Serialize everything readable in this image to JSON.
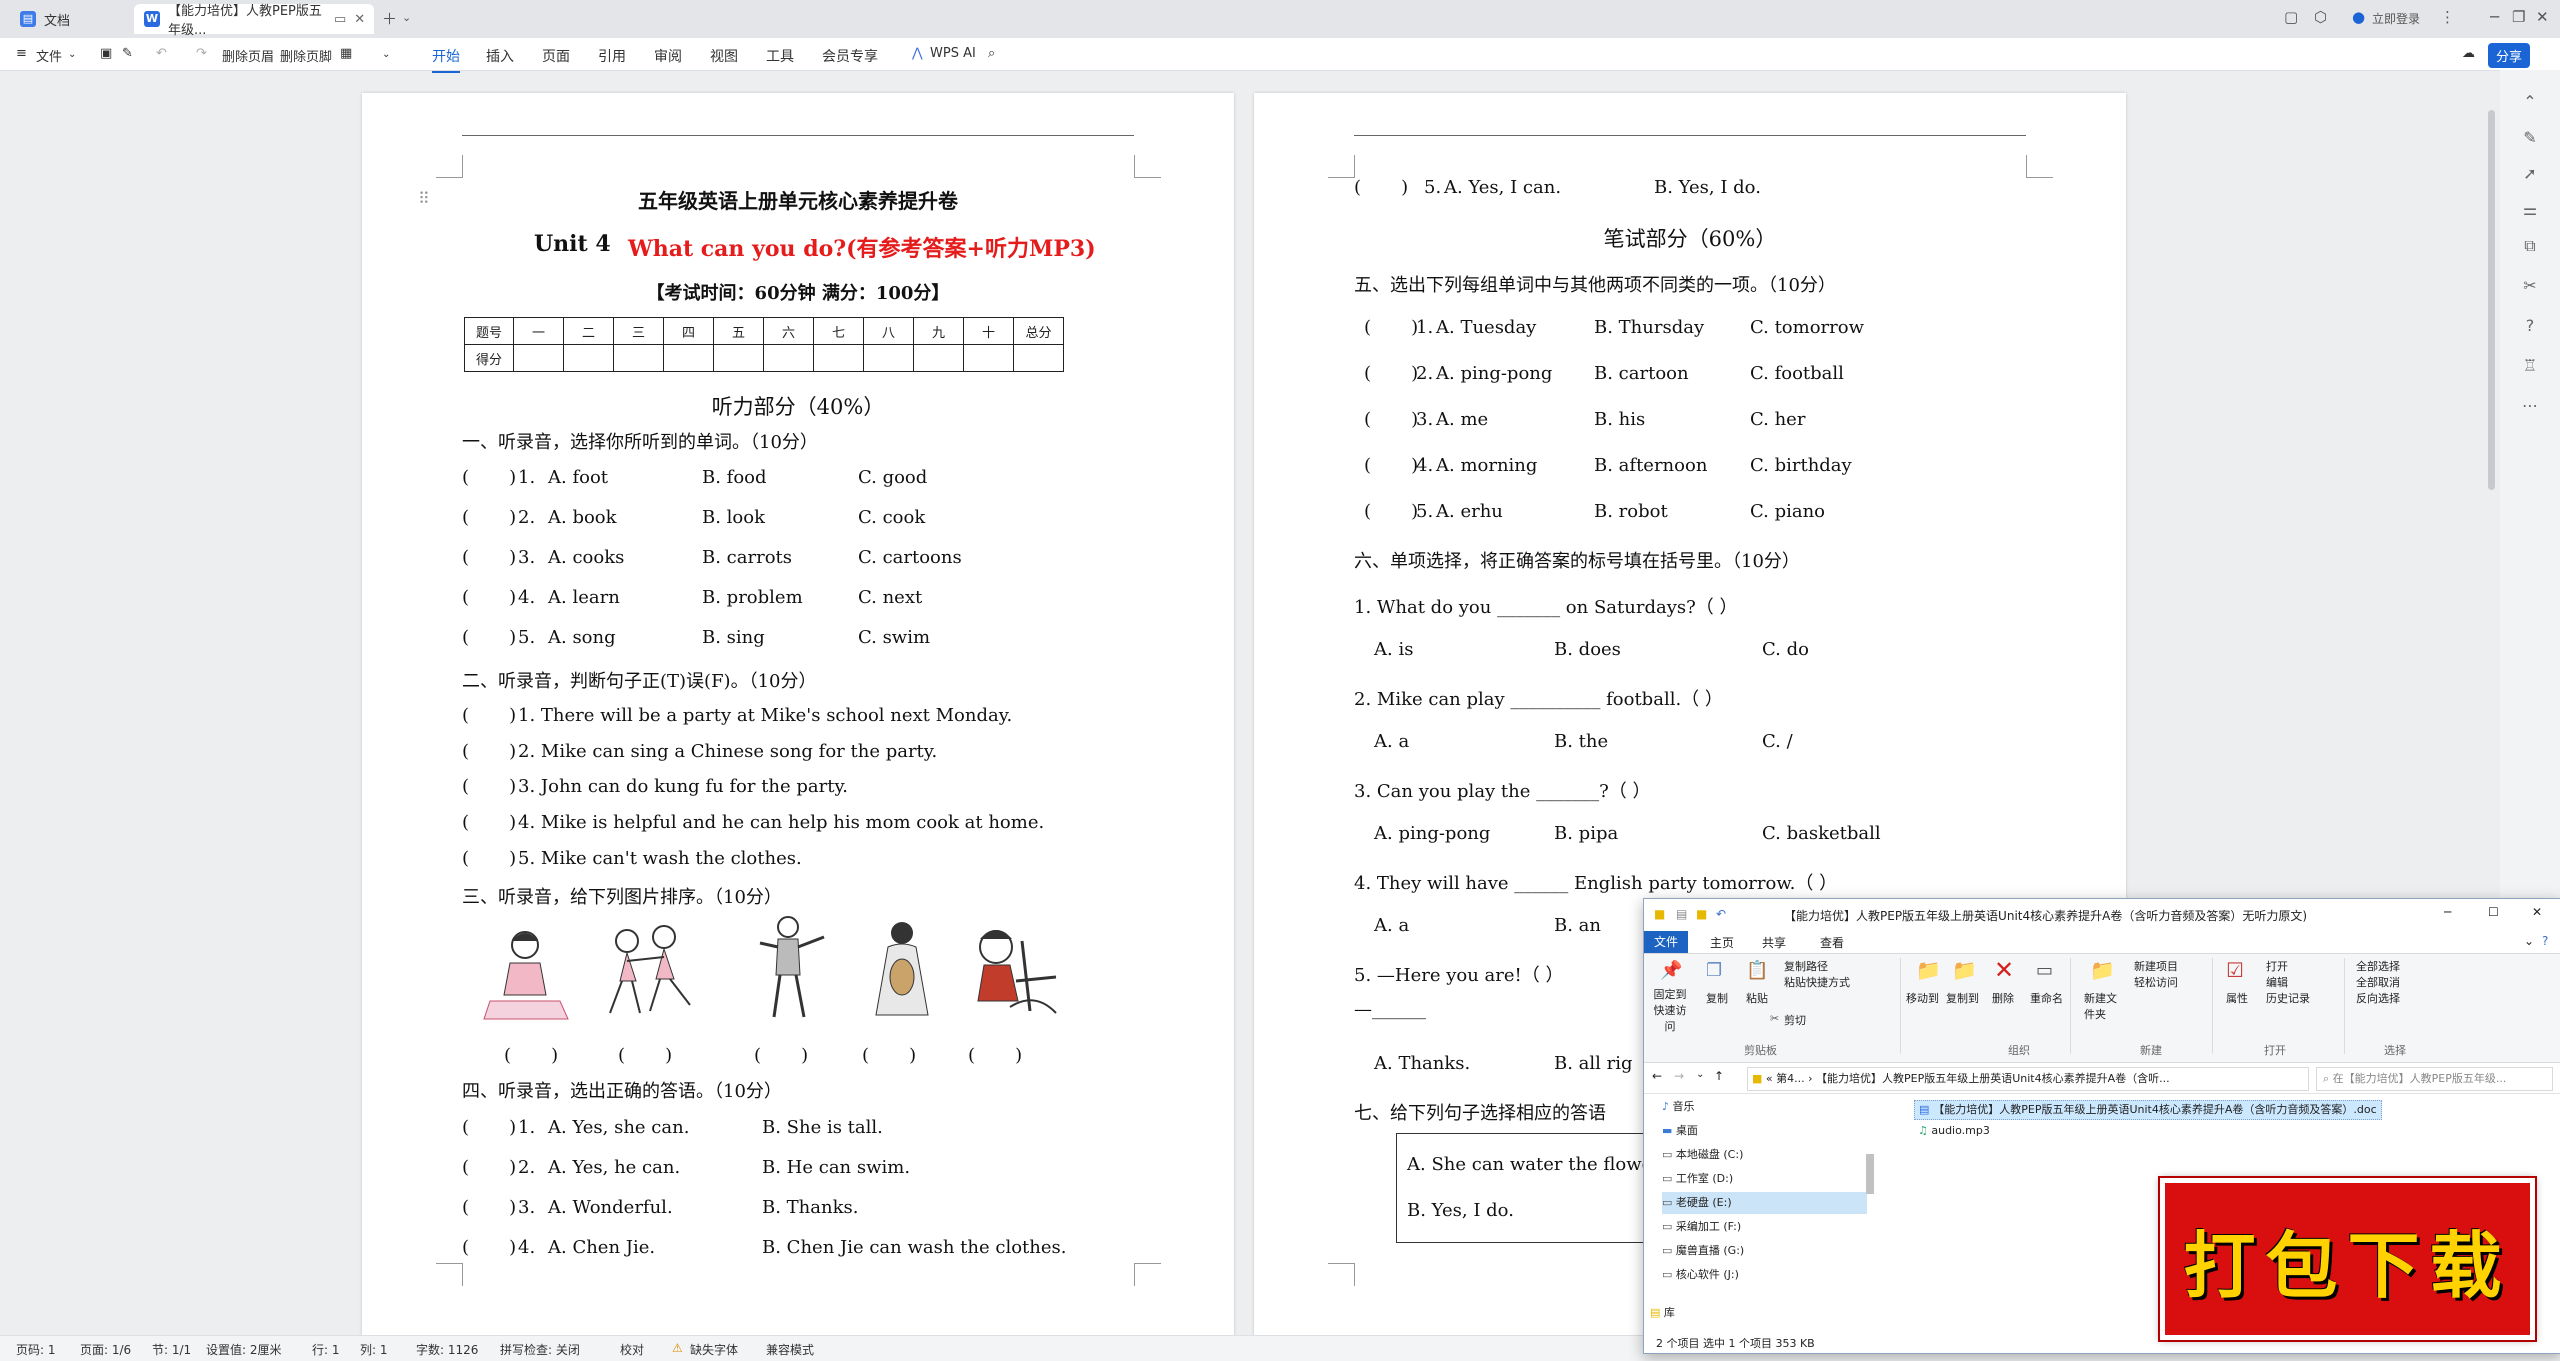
{
  "titlebar": {
    "home_tab": "文档",
    "doc_tab": "【能力培优】人教PEP版五年级...",
    "login": "立即登录"
  },
  "ribbon": {
    "file_menu": "文件",
    "delete_header": "删除页眉",
    "delete_footer": "删除页脚",
    "menus": [
      "开始",
      "插入",
      "页面",
      "引用",
      "审阅",
      "视图",
      "工具",
      "会员专享"
    ],
    "wps_ai": "WPS AI",
    "share": "分享"
  },
  "page1": {
    "title": "五年级英语上册单元核心素养提升卷",
    "unit": "Unit 4",
    "subtitle": "What can you do?(有参考答案+听力MP3)",
    "exam_info": "【考试时间：60分钟 满分：100分】",
    "score_table": {
      "headers": [
        "题号",
        "一",
        "二",
        "三",
        "四",
        "五",
        "六",
        "七",
        "八",
        "九",
        "十",
        "总分"
      ],
      "row_label": "得分"
    },
    "section_listening": "听力部分（40%）",
    "q1_title": "一、听录音，选择你所听到的单词。（10分）",
    "q1_items": [
      {
        "num": "1.",
        "a": "A.   foot",
        "b": "B.   food",
        "c": "C.   good"
      },
      {
        "num": "2.",
        "a": "A.   book",
        "b": "B.   look",
        "c": "C.   cook"
      },
      {
        "num": "3.",
        "a": "A.   cooks",
        "b": "B.   carrots",
        "c": "C.   cartoons"
      },
      {
        "num": "4.",
        "a": "A.   learn",
        "b": "B.   problem",
        "c": "C.   next"
      },
      {
        "num": "5.",
        "a": "A.   song",
        "b": "B.   sing",
        "c": "C.   swim"
      }
    ],
    "q2_title": "二、听录音，判断句子正(T)误(F)。（10分）",
    "q2_items": [
      "1. There will be a party at Mike's school next Monday.",
      "2. Mike can sing a Chinese song for the party.",
      "3. John can do kung fu for the party.",
      "4. Mike is helpful and he can help his mom cook at home.",
      "5. Mike can't wash the clothes."
    ],
    "q3_title": "三、听录音，给下列图片排序。（10分）",
    "q4_title": "四、听录音，选出正确的答语。（10分）",
    "q4_items": [
      {
        "num": "1.",
        "a": "A.   Yes, she can.",
        "b": "B.   She is tall."
      },
      {
        "num": "2.",
        "a": "A.   Yes, he can.",
        "b": "B.   He can swim."
      },
      {
        "num": "3.",
        "a": "A.   Wonderful.",
        "b": "B.   Thanks."
      },
      {
        "num": "4.",
        "a": "A.   Chen Jie.",
        "b": "B.   Chen Jie can wash the clothes."
      }
    ]
  },
  "page2": {
    "q4_5": {
      "num": "5.",
      "a": "A.   Yes, I can.",
      "b": "B.   Yes, I do."
    },
    "section_written": "笔试部分（60%）",
    "q5_title": "五、选出下列每组单词中与其他两项不同类的一项。（10分）",
    "q5_items": [
      {
        "num": "1.",
        "a": "A.   Tuesday",
        "b": "B.   Thursday",
        "c": "C.   tomorrow"
      },
      {
        "num": "2.",
        "a": "A.   ping-pong",
        "b": "B.   cartoon",
        "c": "C.   football"
      },
      {
        "num": "3.",
        "a": "A.   me",
        "b": "B.   his",
        "c": "C.   her"
      },
      {
        "num": "4.",
        "a": "A.   morning",
        "b": "B.   afternoon",
        "c": "C.   birthday"
      },
      {
        "num": "5.",
        "a": "A.   erhu",
        "b": "B.   robot",
        "c": "C.   piano"
      }
    ],
    "q6_title": "六、单项选择，将正确答案的标号填在括号里。（10分）",
    "q6_items": [
      {
        "stem": "1.    What do you _______ on Saturdays?（      ）",
        "a": "A.   is",
        "b": "B.   does",
        "c": "C.   do"
      },
      {
        "stem": "2.    Mike can play __________ football.（      ）",
        "a": "A.   a",
        "b": "B.   the",
        "c": "C.   /"
      },
      {
        "stem": "3.    Can you play the _______?（      ）",
        "a": "A.   ping-pong",
        "b": "B.   pipa",
        "c": "C.   basketball"
      },
      {
        "stem": "4.    They will have ______ English party tomorrow.（      ）",
        "a": "A.   a",
        "b": "B.   an",
        "c": ""
      },
      {
        "stem": "5.    —Here you are!（      ）",
        "a": "A.   Thanks.",
        "b": "B.   all rig",
        "c": ""
      }
    ],
    "q6_5_line2": "—______",
    "q7_title": "七、给下列句子选择相应的答语",
    "q7_options": [
      "A.   She can water the flower",
      "B.   Yes, I do."
    ]
  },
  "explorer": {
    "title": "【能力培优】人教PEP版五年级上册英语Unit4核心素养提升A卷（含听力音频及答案）无听力原文)",
    "tabs": [
      "文件",
      "主页",
      "共享",
      "查看"
    ],
    "ribbon_items": {
      "pin": "固定到快速访问",
      "copy": "复制",
      "paste": "粘贴",
      "copy_path": "复制路径",
      "paste_shortcut": "粘贴快捷方式",
      "cut": "剪切",
      "move_to": "移动到",
      "copy_to": "复制到",
      "delete": "删除",
      "rename": "重命名",
      "new_folder": "新建文件夹",
      "new_item": "新建项目",
      "easy_access": "轻松访问",
      "properties": "属性",
      "open": "打开",
      "edit": "编辑",
      "history": "历史记录",
      "select_all": "全部选择",
      "select_none": "全部取消",
      "invert": "反向选择"
    },
    "groups": [
      "剪贴板",
      "组织",
      "新建",
      "打开",
      "选择"
    ],
    "address": "« 第4... › 【能力培优】人教PEP版五年级上册英语Unit4核心素养提升A卷（含听...",
    "search_placeholder": "在【能力培优】人教PEP版五年级...",
    "nav": [
      "音乐",
      "桌面",
      "本地磁盘 (C:)",
      "工作室 (D:)",
      "老硬盘 (E:)",
      "采编加工 (F:)",
      "魔兽直播 (G:)",
      "核心软件 (J:)",
      "库"
    ],
    "files": [
      "【能力培优】人教PEP版五年级上册英语Unit4核心素养提升A卷（含听力音频及答案）.doc",
      "audio.mp3"
    ],
    "status": "2 个项目    选中 1 个项目  353 KB"
  },
  "statusbar": {
    "page_num": "页码: 1",
    "page_total": "页面: 1/6",
    "section": "节: 1/1",
    "setting": "设置值: 2厘米",
    "row": "行: 1",
    "col": "列: 1",
    "words": "字数: 1126",
    "spell": "拼写检查: 关闭",
    "proof": "校对",
    "missing_font": "缺失字体",
    "compat": "兼容模式"
  },
  "badge": {
    "text": "打包下载"
  }
}
